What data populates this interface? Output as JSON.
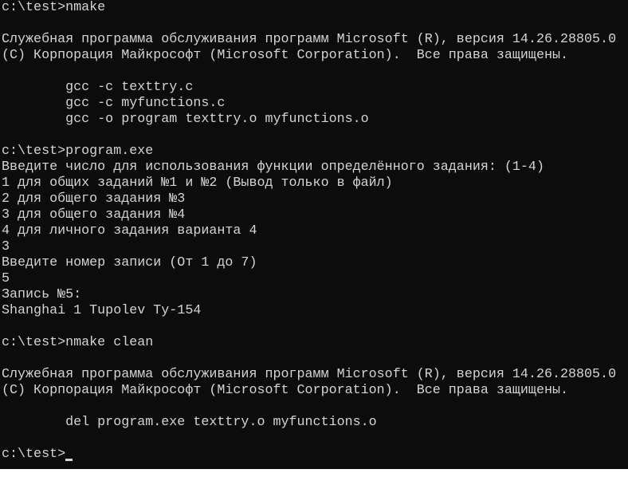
{
  "console": {
    "lines": [
      "c:\\test>nmake",
      "",
      "Служебная программа обслуживания программ Microsoft (R), версия 14.26.28805.0",
      "(C) Корпорация Майкрософт (Microsoft Corporation).  Все права защищены.",
      "",
      "        gcc -c texttry.c",
      "        gcc -c myfunctions.c",
      "        gcc -o program texttry.o myfunctions.o",
      "",
      "c:\\test>program.exe",
      "Введите число для использования функции определённого задания: (1-4)",
      "1 для общих заданий №1 и №2 (Вывод только в файл)",
      "2 для общего задания №3",
      "3 для общего задания №4",
      "4 для личного задания варианта 4",
      "3",
      "Введите номер записи (От 1 до 7)",
      "5",
      "Запись №5:",
      "Shanghai 1 Tupolev Ty-154",
      "",
      "c:\\test>nmake clean",
      "",
      "Служебная программа обслуживания программ Microsoft (R), версия 14.26.28805.0",
      "(C) Корпорация Майкрософт (Microsoft Corporation).  Все права защищены.",
      "",
      "        del program.exe texttry.o myfunctions.o",
      ""
    ],
    "prompt": "c:\\test>",
    "colors": {
      "background": "#0c0c0c",
      "foreground": "#d4d4d4"
    }
  }
}
